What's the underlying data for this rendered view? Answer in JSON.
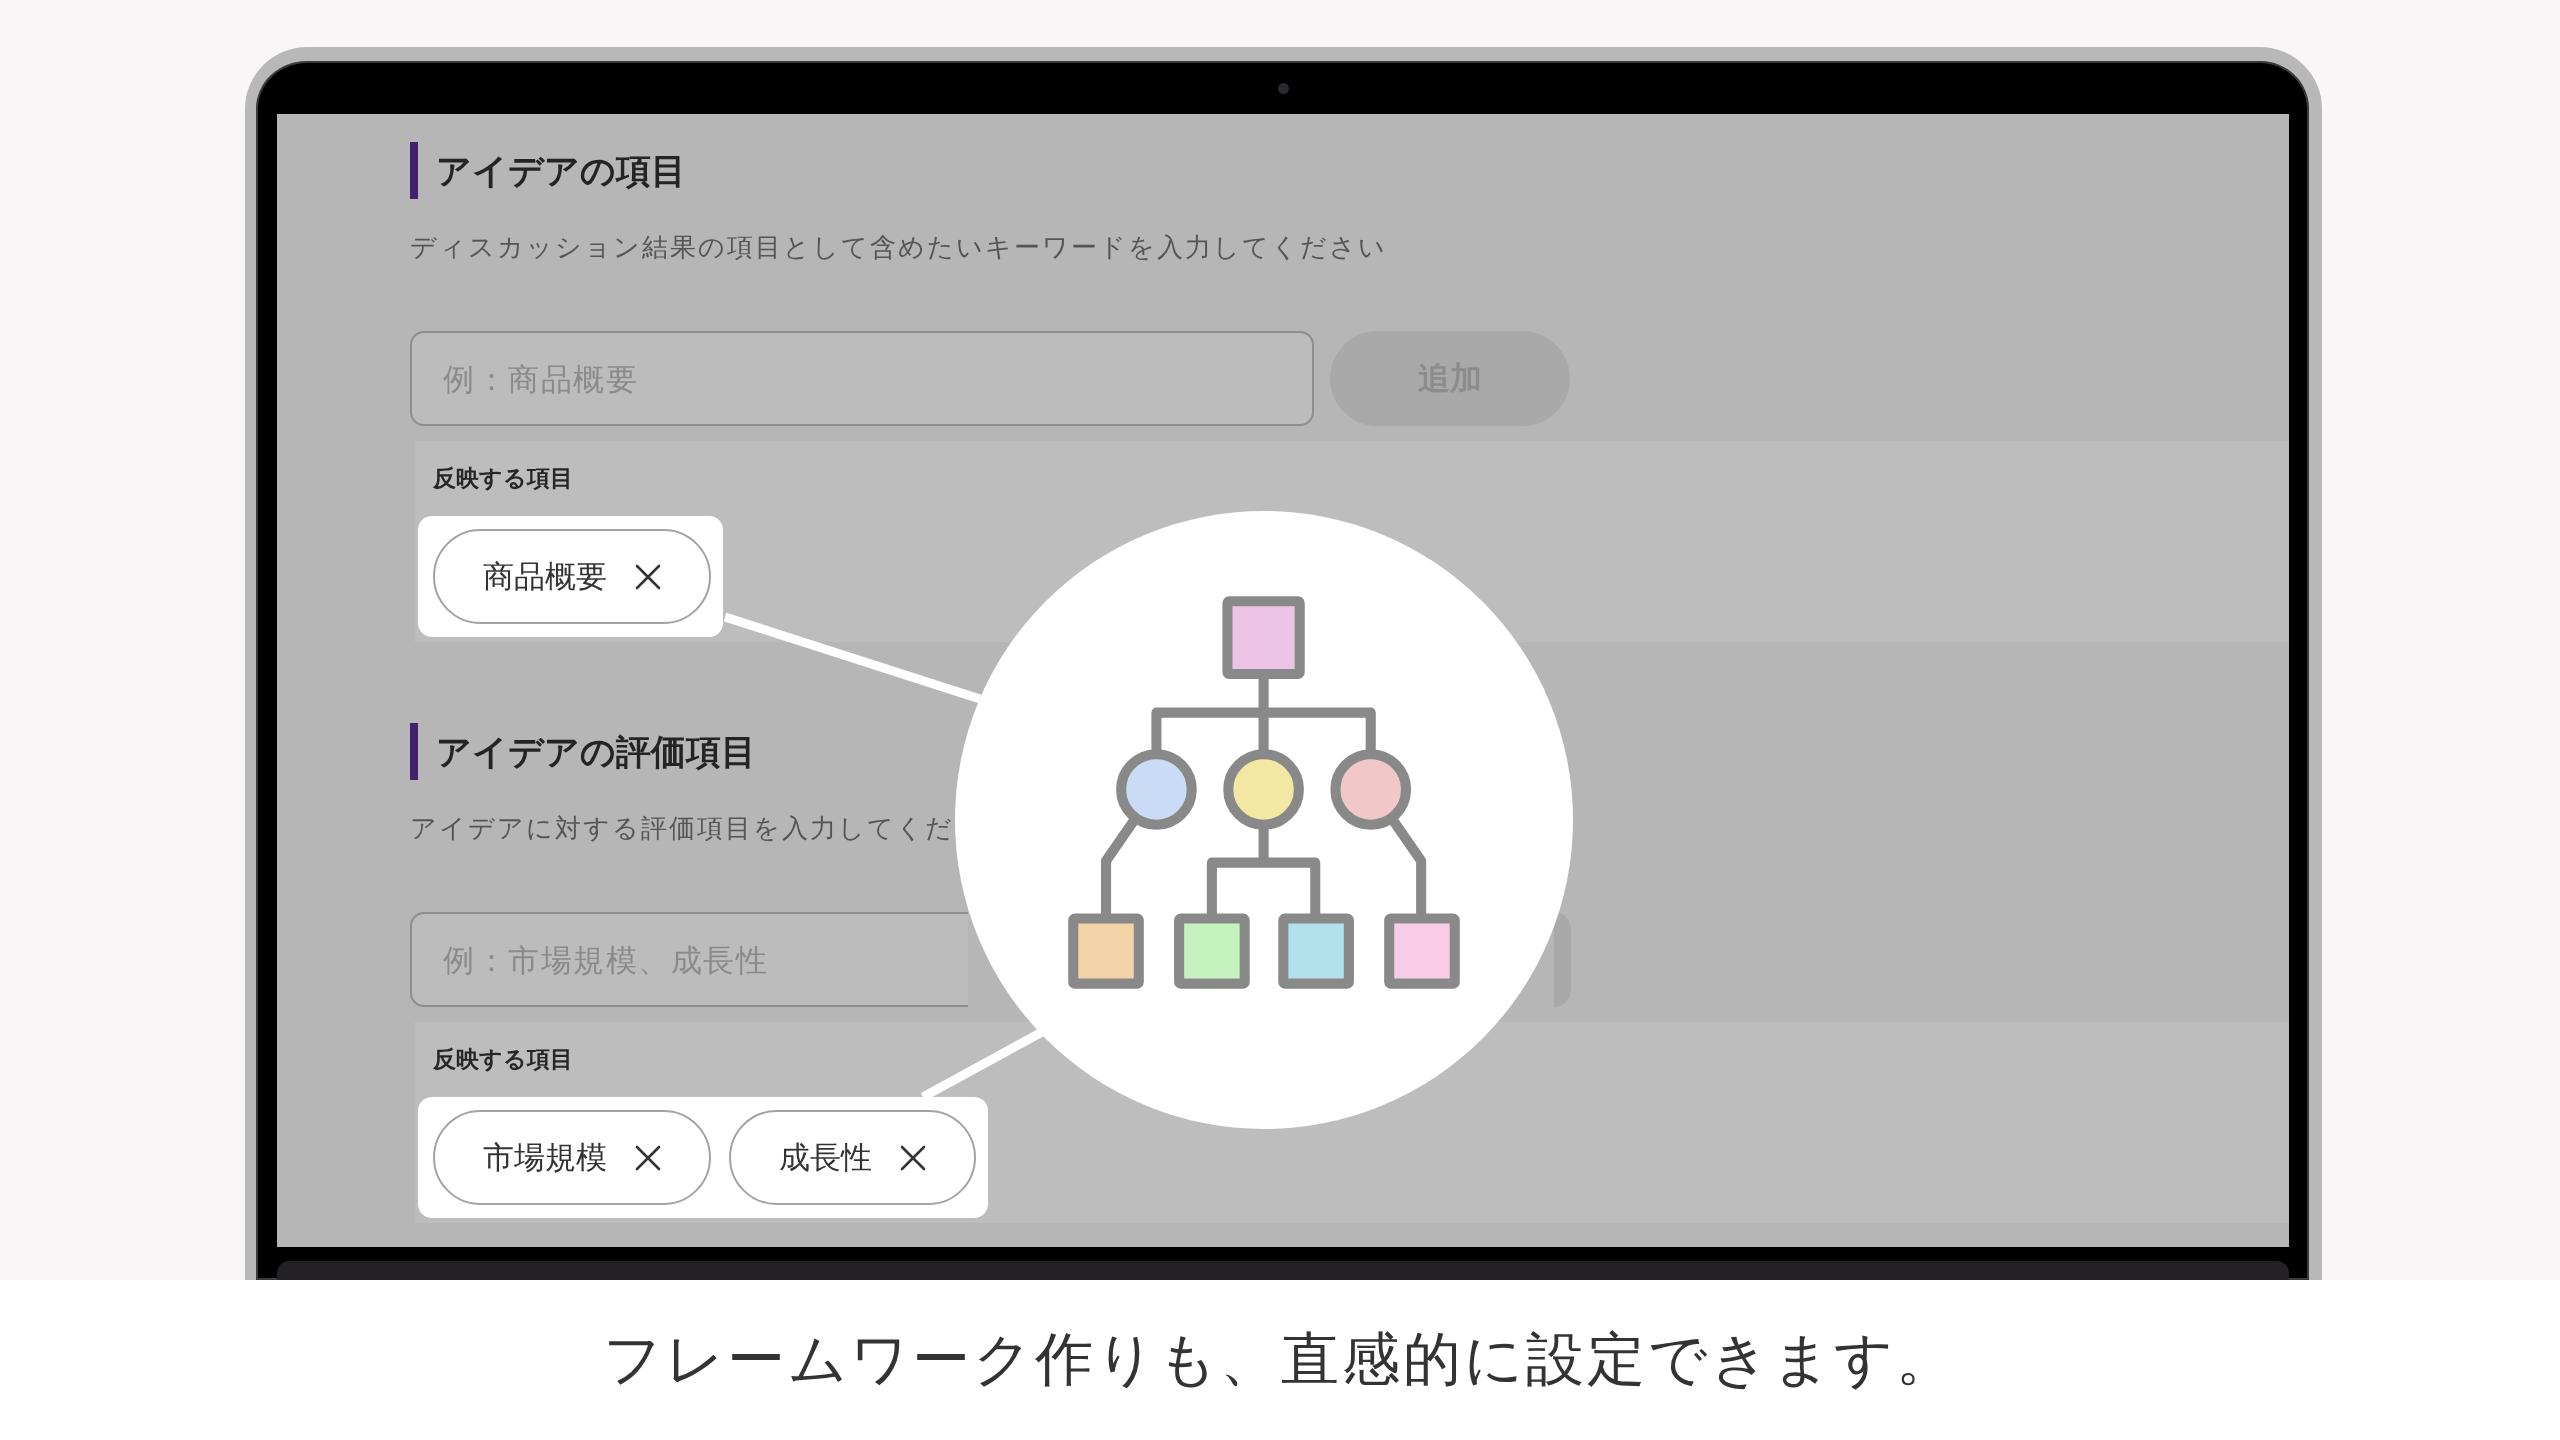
{
  "sections": [
    {
      "title": "アイデアの項目",
      "description": "ディスカッション結果の項目として含めたいキーワードを入力してください",
      "input": {
        "placeholder": "例：商品概要"
      },
      "add_button": {
        "label": "追加",
        "disabled": true
      },
      "reflected": {
        "label": "反映する項目",
        "highlighted": true,
        "items": [
          {
            "label": "商品概要"
          }
        ]
      }
    },
    {
      "title": "アイデアの評価項目",
      "description": "アイデアに対する評価項目を入力してくだ",
      "input": {
        "placeholder": "例：市場規模、成長性"
      },
      "add_button": {
        "disabled": true
      },
      "reflected": {
        "label": "反映する項目",
        "highlighted": true,
        "items": [
          {
            "label": "市場規模"
          },
          {
            "label": "成長性"
          }
        ]
      }
    }
  ],
  "caption": "フレームワーク作りも、直感的に設定できます。"
}
